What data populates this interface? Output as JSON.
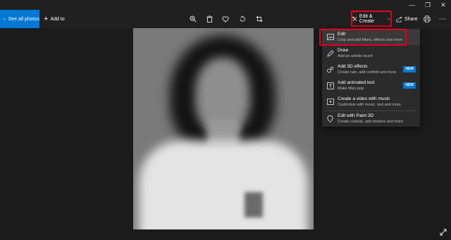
{
  "toolbar": {
    "see_all_label": "See all photos",
    "add_to_label": "Add to",
    "edit_create_label": "Edit & Create",
    "share_label": "Share"
  },
  "menu": {
    "items": [
      {
        "title": "Edit",
        "subtitle": "Crop and add filters, effects and more",
        "icon": "edit-photo-icon",
        "badge": ""
      },
      {
        "title": "Draw",
        "subtitle": "Add an artistic touch",
        "icon": "pen-icon",
        "badge": ""
      },
      {
        "title": "Add 3D effects",
        "subtitle": "Create rain, add confetti and more",
        "icon": "3d-effects-icon",
        "badge": "NEW"
      },
      {
        "title": "Add animated text",
        "subtitle": "Make titles pop",
        "icon": "animated-text-icon",
        "badge": "NEW"
      },
      {
        "title": "Create a video with music",
        "subtitle": "Customise with music, text and more",
        "icon": "video-icon",
        "badge": ""
      },
      {
        "title": "Edit with Paint 3D",
        "subtitle": "Create cutouts, add stickers and more",
        "icon": "paint3d-icon",
        "badge": ""
      }
    ]
  },
  "colors": {
    "accent": "#0078d4",
    "highlight_border": "#e0001b",
    "menu_bg": "#2b2b2b",
    "app_bg": "#1b1b1b"
  }
}
